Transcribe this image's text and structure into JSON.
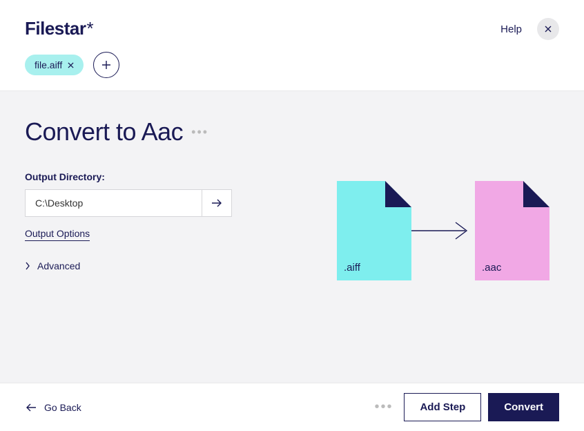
{
  "header": {
    "logo_text": "Filestar",
    "logo_suffix": "*",
    "help_label": "Help",
    "file_chip_label": "file.aiff"
  },
  "main": {
    "title": "Convert to Aac",
    "output_dir_label": "Output Directory:",
    "output_dir_value": "C:\\Desktop",
    "output_options_label": "Output Options",
    "advanced_label": "Advanced",
    "source_ext": ".aiff",
    "target_ext": ".aac"
  },
  "footer": {
    "go_back_label": "Go Back",
    "add_step_label": "Add Step",
    "convert_label": "Convert"
  }
}
